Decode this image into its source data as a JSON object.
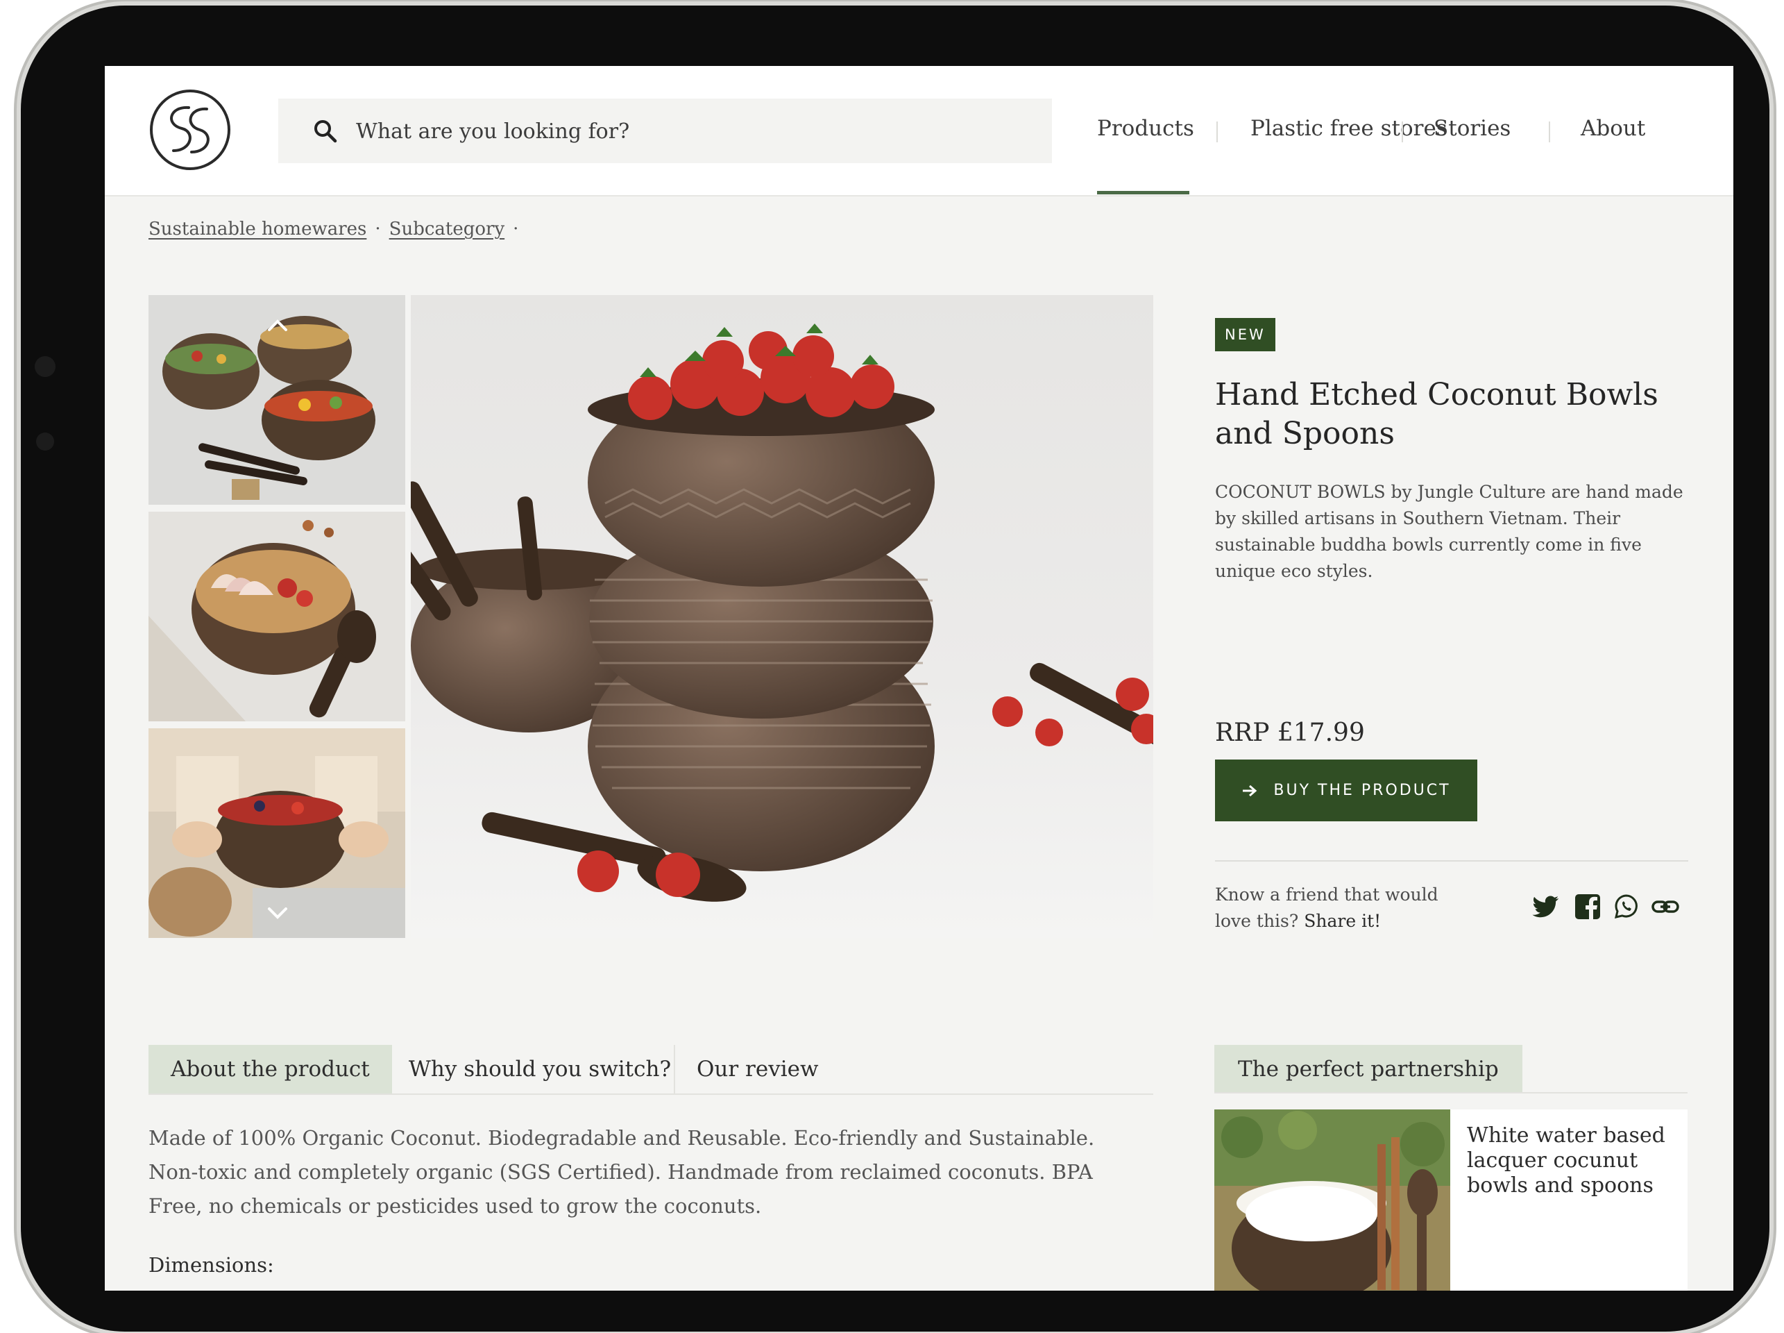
{
  "header": {
    "search_placeholder": "What are you looking for?",
    "nav": [
      "Products",
      "Plastic free stores",
      "Stories",
      "About"
    ],
    "active_nav": "Products"
  },
  "breadcrumb": [
    "Sustainable homewares",
    "Subcategory"
  ],
  "product": {
    "badge": "NEW",
    "title": "Hand Etched Coconut Bowls and Spoons",
    "description": "COCONUT BOWLS by Jungle Culture are hand made by skilled artisans in Southern Vietnam. Their sustainable buddha bowls currently come in five unique eco styles.",
    "price": "RRP £17.99",
    "buy_label": "BUY THE PRODUCT",
    "share_text": "Know a friend that would love this?",
    "share_link": "Share it!"
  },
  "share_icons": [
    "twitter-icon",
    "facebook-icon",
    "whatsapp-icon",
    "link-icon"
  ],
  "tabs": [
    "About the product",
    "Why should you switch?",
    "Our review"
  ],
  "about": {
    "text": "Made of 100% Organic Coconut. Biodegradable and Reusable. Eco-friendly and Sustainable. Non-toxic and completely organic (SGS Certified). Handmade from reclaimed coconuts. BPA Free, no chemicals or pesticides used to grow the coconuts.",
    "dimensions_label": "Dimensions:"
  },
  "partnership": {
    "tab": "The perfect partnership",
    "card_title": "White water based lacquer cocunut bowls and spoons"
  },
  "colors": {
    "accent": "#304e24",
    "tab_active": "#dbe3d6",
    "background": "#f4f4f2"
  }
}
